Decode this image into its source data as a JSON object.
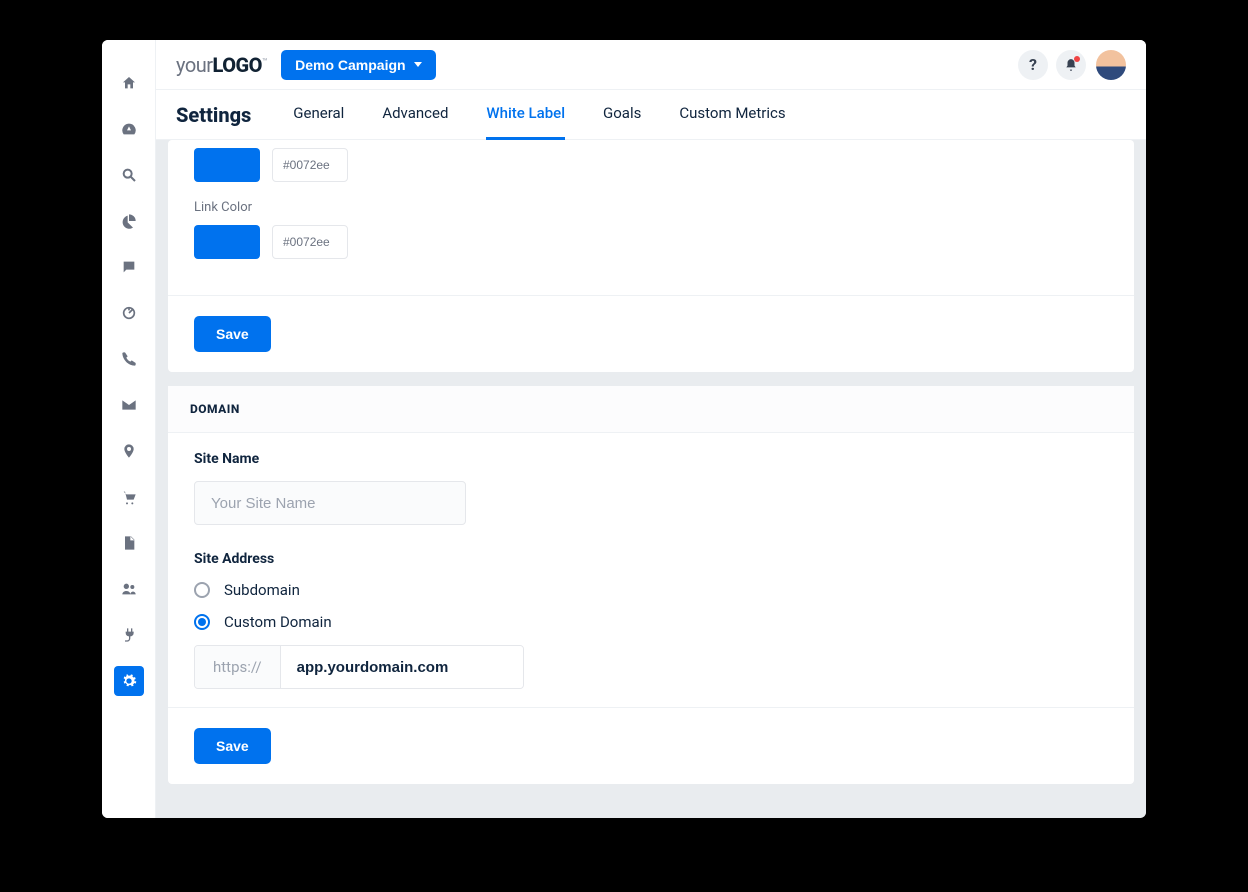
{
  "logo": {
    "part1": "your",
    "part2": "LOGO",
    "tm": "™"
  },
  "campaign_selector": {
    "label": "Demo Campaign"
  },
  "topbar": {
    "help_symbol": "?"
  },
  "page_title": "Settings",
  "tabs": {
    "general": "General",
    "advanced": "Advanced",
    "white_label": "White Label",
    "goals": "Goals",
    "custom_metrics": "Custom Metrics"
  },
  "colors_section": {
    "primary_hex": "#0072ee",
    "link_label": "Link Color",
    "link_hex": "#0072ee",
    "swatch_color": "#0072ee",
    "save_label": "Save"
  },
  "domain_section": {
    "header": "DOMAIN",
    "site_name_label": "Site Name",
    "site_name_placeholder": "Your Site Name",
    "site_name_value": "",
    "site_address_label": "Site Address",
    "radio_subdomain": "Subdomain",
    "radio_custom": "Custom Domain",
    "protocol_prefix": "https://",
    "domain_value": "app.yourdomain.com",
    "save_label": "Save"
  }
}
